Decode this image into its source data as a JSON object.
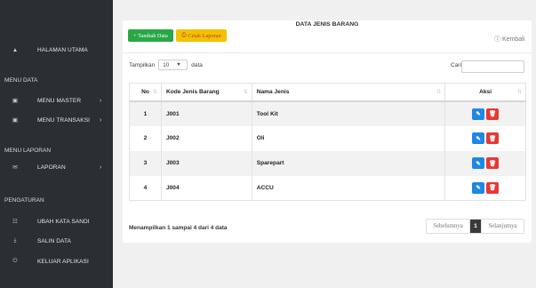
{
  "sidebar": {
    "home_label": "HALAMAN UTAMA",
    "sections": {
      "menu_data": "MENU DATA",
      "menu_laporan": "MENU LAPORAN",
      "pengaturan": "PENGATURAN"
    },
    "items": {
      "menu_master": "MENU MASTER",
      "menu_transaksi": "MENU TRANSAKSI",
      "laporan": "LAPORAN",
      "ubah_kata_sandi": "UBAH KATA SANDI",
      "salin_data": "SALIN DATA",
      "keluar_aplikasi": "KELUAR APLIKASI"
    },
    "chevron": "›"
  },
  "panel": {
    "title": "DATA JENIS BARANG",
    "add_button": "+ Tambah Data",
    "print_button": "Cetak Laporan",
    "back_link": "Kembali"
  },
  "controls": {
    "show_label": "Tampilkan",
    "show_value": "10",
    "show_suffix": "data",
    "search_label": "Cari:"
  },
  "table": {
    "headers": {
      "no": "No",
      "kode": "Kode Jenis Barang",
      "nama": "Nama Jenis",
      "aksi": "Aksi"
    },
    "rows": [
      {
        "no": "1",
        "kode": "J001",
        "nama": "Tool Kit"
      },
      {
        "no": "2",
        "kode": "J002",
        "nama": "Oli"
      },
      {
        "no": "3",
        "kode": "J003",
        "nama": "Sparepart"
      },
      {
        "no": "4",
        "kode": "J004",
        "nama": "ACCU"
      }
    ]
  },
  "footer": {
    "info": "Menampilkan 1 sampai 4 dari 4 data",
    "prev": "Sebelumnya",
    "current_page": "1",
    "next": "Selanjutnya"
  },
  "colors": {
    "sidebar_bg": "#2b2f33",
    "add_button": "#28a745",
    "print_button": "#f2c200",
    "edit_button": "#1e88e5",
    "delete_button": "#e53935"
  }
}
